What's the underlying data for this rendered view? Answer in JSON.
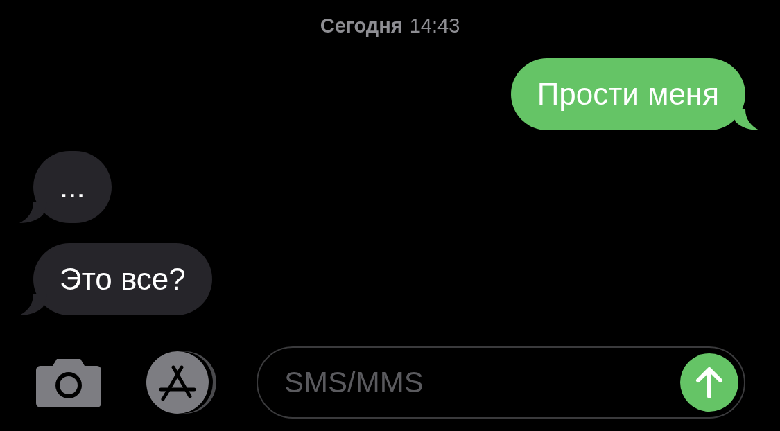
{
  "timestamp": {
    "day": "Сегодня",
    "time": "14:43"
  },
  "messages": [
    {
      "kind": "outgoing",
      "text": "Прости меня"
    },
    {
      "kind": "incoming",
      "text": "..."
    },
    {
      "kind": "incoming",
      "text": "Это все?"
    }
  ],
  "composer": {
    "placeholder": "SMS/MMS"
  }
}
